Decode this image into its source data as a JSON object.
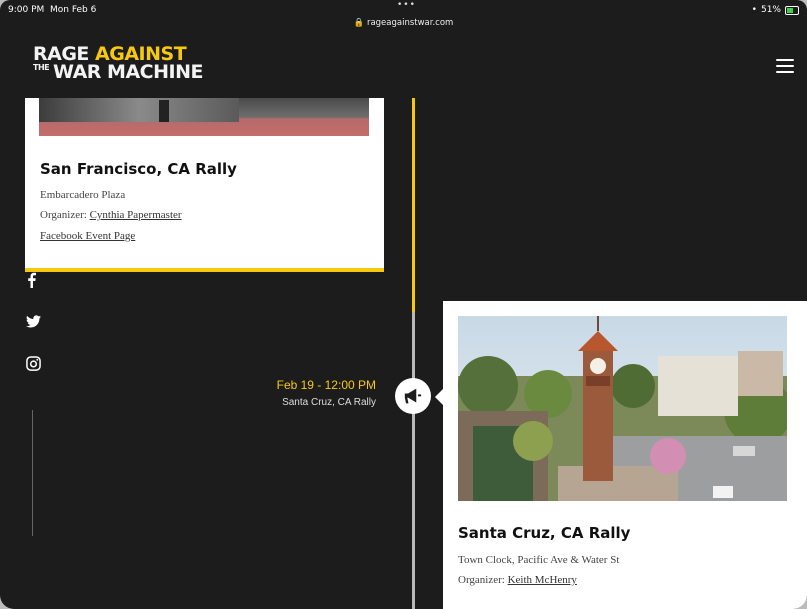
{
  "status": {
    "time": "9:00 PM",
    "date": "Mon Feb 6",
    "dots": "•••",
    "url": "rageagainstwar.com",
    "battery": "51%"
  },
  "logo": {
    "line1_white": "RAGE ",
    "line1_yellow": "AGAINST",
    "line2_prefix": "THE",
    "line2": "WAR MACHINE"
  },
  "colors": {
    "accent": "#f7c90e",
    "background": "#1c1c1c"
  },
  "cards": [
    {
      "title": "San Francisco, CA Rally",
      "location": "Embarcadero Plaza",
      "organizer_label": "Organizer: ",
      "organizer": "Cynthia Papermaster",
      "link": "Facebook Event Page"
    },
    {
      "title": "Santa Cruz, CA Rally",
      "location": "Town Clock, Pacific Ave & Water St",
      "organizer_label": "Organizer: ",
      "organizer": "Keith McHenry"
    }
  ],
  "event": {
    "date": "Feb 19 - 12:00 PM",
    "name": "Santa Cruz, CA Rally",
    "icon": "megaphone-icon"
  },
  "social": [
    "facebook-icon",
    "twitter-icon",
    "instagram-icon"
  ],
  "timeline_progress": 0.42
}
